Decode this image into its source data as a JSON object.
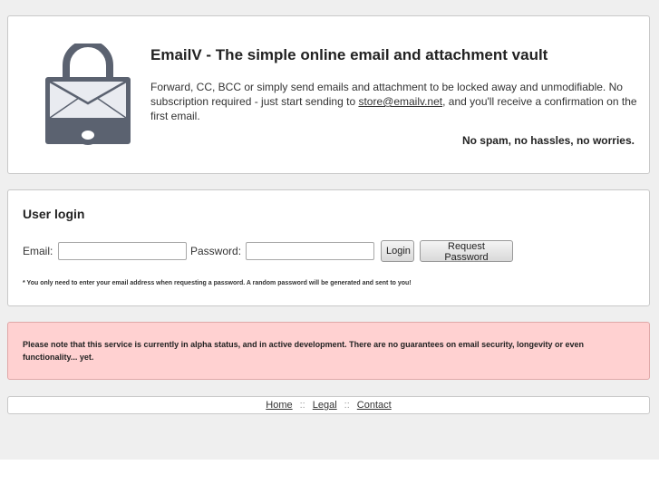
{
  "intro": {
    "title": "EmailV - The simple online email and attachment vault",
    "description_before": "Forward, CC, BCC or simply send emails and attachment to be locked away and unmodifiable. No subscription required - just start sending to ",
    "email_link": "store@emailv.net",
    "description_after": ", and you'll receive a confirmation on the first email.",
    "tagline": "No spam, no hassles, no worries.",
    "logo_icon": "padlock-envelope-key-icon"
  },
  "login": {
    "title": "User login",
    "email_label": "Email:",
    "email_value": "",
    "password_label": "Password:",
    "password_value": "",
    "login_button": "Login",
    "request_button": "Request Password",
    "note": "* You only need to enter your email address when requesting a password. A random password will be generated and sent to you!"
  },
  "notice": {
    "text": "Please note that this service is currently in alpha status, and in active development. There are no guarantees on email security, longevity or even functionality... yet.",
    "background_color": "#ffd1d1"
  },
  "footer": {
    "links": [
      "Home",
      "Legal",
      "Contact"
    ],
    "separator": "::"
  }
}
